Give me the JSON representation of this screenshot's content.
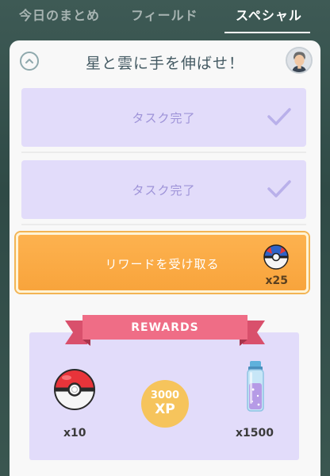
{
  "tabs": [
    {
      "label": "今日のまとめ",
      "active": false
    },
    {
      "label": "フィールド",
      "active": false
    },
    {
      "label": "スペシャル",
      "active": true
    }
  ],
  "card": {
    "title": "星と雲に手を伸ばせ！",
    "tasks": [
      {
        "label": "タスク完了",
        "done": true
      },
      {
        "label": "タスク完了",
        "done": true
      }
    ],
    "reward_button": {
      "label": "リワードを受け取る",
      "item_icon": "great-ball-icon",
      "count": "x25"
    }
  },
  "rewards": {
    "title": "REWARDS",
    "items": [
      {
        "icon": "poke-ball-icon",
        "count": "x10"
      },
      {
        "icon": "xp-icon",
        "amount": "3000",
        "unit": "XP"
      },
      {
        "icon": "stardust-icon",
        "count": "x1500"
      }
    ]
  },
  "colors": {
    "task_bg": "#e2dcfa",
    "reward_button": "#f8a43c",
    "ribbon": "#ef6d86",
    "xp_coin": "#f6c45c"
  }
}
